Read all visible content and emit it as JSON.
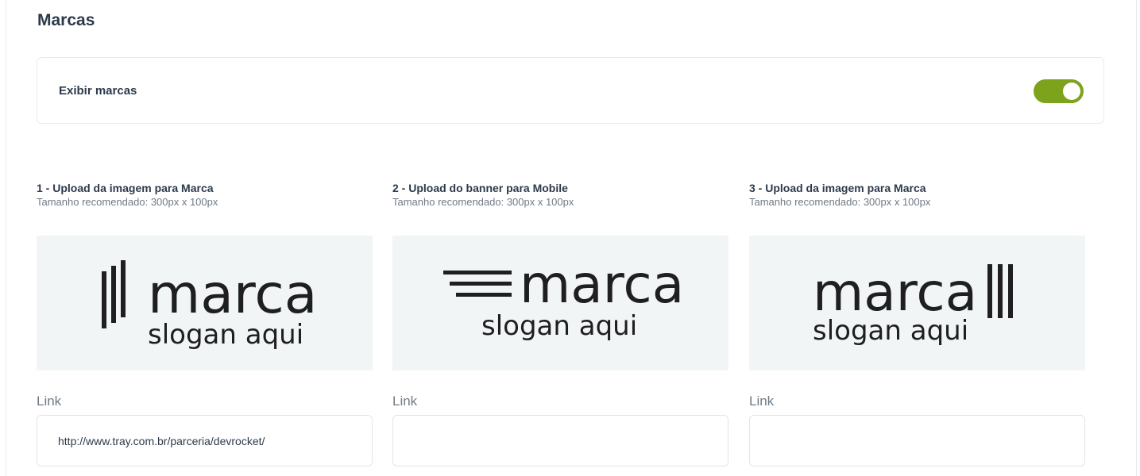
{
  "section": {
    "title": "Marcas",
    "toggle": {
      "label": "Exibir marcas",
      "enabled": true,
      "color": "#7da21b"
    }
  },
  "uploads": [
    {
      "title": "1 - Upload da imagem para Marca",
      "hint": "Tamanho recomendado: 300px x 100px",
      "preview": {
        "brand": "marca",
        "slogan": "slogan aqui",
        "icon": "vertical-bars-icon"
      },
      "link_label": "Link",
      "link_value": "http://www.tray.com.br/parceria/devrocket/"
    },
    {
      "title": "2 - Upload do banner para Mobile",
      "hint": "Tamanho recomendado: 300px x 100px",
      "preview": {
        "brand": "marca",
        "slogan": "slogan aqui",
        "icon": "horizontal-lines-icon"
      },
      "link_label": "Link",
      "link_value": ""
    },
    {
      "title": "3 - Upload da imagem para Marca",
      "hint": "Tamanho recomendado: 300px x 100px",
      "preview": {
        "brand": "marca",
        "slogan": "slogan aqui",
        "icon": "vertical-bars-icon"
      },
      "link_label": "Link",
      "link_value": ""
    }
  ]
}
